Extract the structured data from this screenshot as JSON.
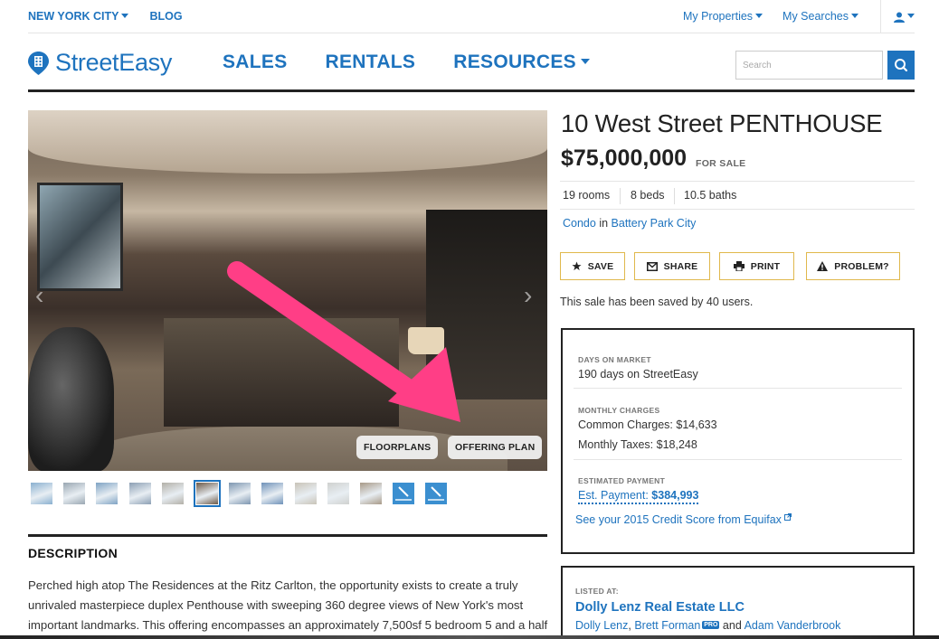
{
  "topbar": {
    "city": "NEW YORK CITY",
    "blog": "BLOG",
    "my_properties": "My Properties",
    "my_searches": "My Searches"
  },
  "header": {
    "logo": "StreetEasy",
    "nav": {
      "sales": "SALES",
      "rentals": "RENTALS",
      "resources": "RESOURCES"
    },
    "search_placeholder": "Search"
  },
  "photo": {
    "floorplans_label": "FLOORPLANS",
    "offering_plan_label": "OFFERING PLAN",
    "thumb_count": 13,
    "active_thumb": 5
  },
  "listing": {
    "title": "10 West Street PENTHOUSE",
    "price": "$75,000,000",
    "status": "FOR SALE",
    "rooms": "19 rooms",
    "beds": "8 beds",
    "baths": "10.5 baths",
    "type": "Condo",
    "in_word": "in",
    "neighborhood": "Battery Park City",
    "saved_text": "This sale has been saved by 40 users."
  },
  "actions": {
    "save": "SAVE",
    "share": "SHARE",
    "print": "PRINT",
    "problem": "PROBLEM?"
  },
  "details": {
    "days_label": "DAYS ON MARKET",
    "days_value": "190 days on StreetEasy",
    "charges_label": "MONTHLY CHARGES",
    "common_charges": "Common Charges: $14,633",
    "monthly_taxes": "Monthly Taxes: $18,248",
    "payment_label": "ESTIMATED PAYMENT",
    "est_prefix": "Est. Payment:",
    "est_value": "$384,993",
    "credit_link": "See your 2015 Credit Score from Equifax"
  },
  "listed": {
    "label": "LISTED AT:",
    "company": "Dolly Lenz Real Estate LLC",
    "agent1": "Dolly Lenz",
    "agent2": "Brett Forman",
    "pro": "PRO",
    "and_word": "and",
    "agent3": "Adam Vanderbrook"
  },
  "description": {
    "title": "DESCRIPTION",
    "line1": "Perched high atop The Residences at the Ritz Carlton, the opportunity exists to create a truly",
    "line2": "unrivaled masterpiece duplex Penthouse with sweeping 360 degree views of New York's most",
    "line3": "important landmarks. This offering encompasses an approximately 7,500sf 5 bedroom 5 and a half"
  },
  "colors": {
    "brand_blue": "#1e73be",
    "annotation_pink": "#ff3e86",
    "action_border": "#e0b84c"
  }
}
